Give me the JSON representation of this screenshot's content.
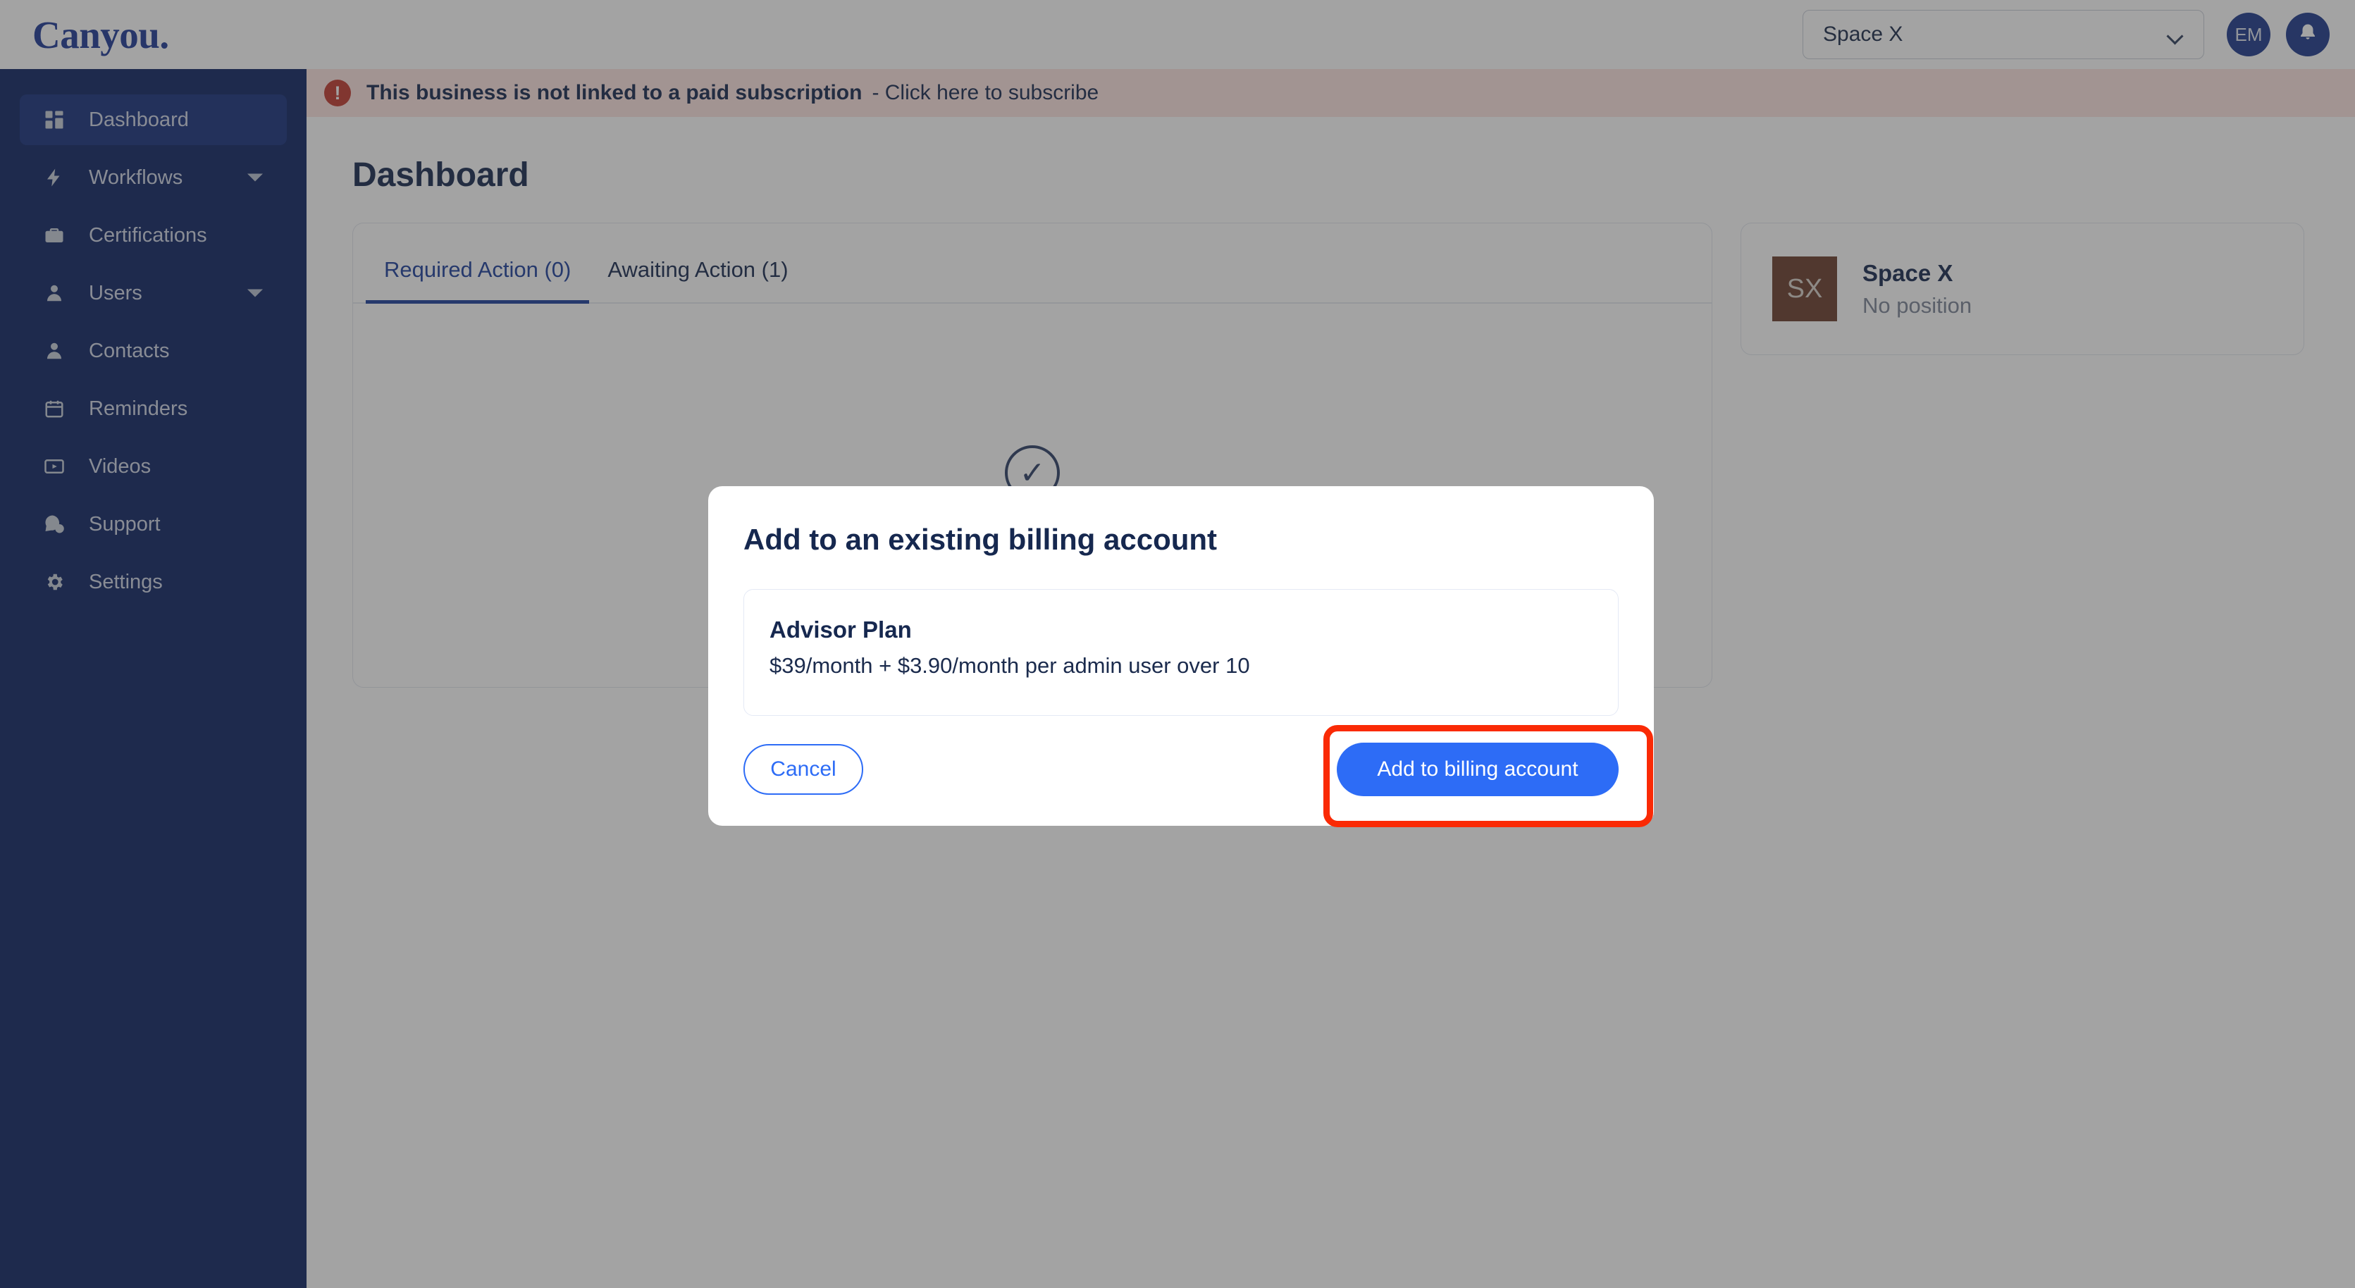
{
  "brand": {
    "logo_text": "Canyou.",
    "color": "#1e3a96"
  },
  "topbar": {
    "org_selector_value": "Space X",
    "avatar_initials": "EM",
    "notifications_icon": "bell-icon",
    "dropdown_icon": "chevron-down-icon"
  },
  "banner": {
    "icon": "alert-circle-icon",
    "message": "This business is not linked to a paid subscription",
    "link_text": "- Click here to subscribe",
    "background": "#fde3e1"
  },
  "sidebar": {
    "items": [
      {
        "label": "Dashboard",
        "icon": "grid-dashboard-icon",
        "active": true,
        "caret": false
      },
      {
        "label": "Workflows",
        "icon": "bolt-icon",
        "active": false,
        "caret": true
      },
      {
        "label": "Certifications",
        "icon": "briefcase-icon",
        "active": false,
        "caret": false
      },
      {
        "label": "Users",
        "icon": "user-icon",
        "active": false,
        "caret": true
      },
      {
        "label": "Contacts",
        "icon": "contact-person-icon",
        "active": false,
        "caret": false
      },
      {
        "label": "Reminders",
        "icon": "calendar-icon",
        "active": false,
        "caret": false
      },
      {
        "label": "Videos",
        "icon": "video-play-icon",
        "active": false,
        "caret": false
      },
      {
        "label": "Support",
        "icon": "chat-help-icon",
        "active": false,
        "caret": false
      },
      {
        "label": "Settings",
        "icon": "gear-icon",
        "active": false,
        "caret": false
      }
    ]
  },
  "page": {
    "title": "Dashboard",
    "tabs": [
      {
        "label": "Required Action (0)",
        "active": true
      },
      {
        "label": "Awaiting Action (1)",
        "active": false
      }
    ],
    "side_card": {
      "avatar_initials": "SX",
      "name": "Space X",
      "subtitle": "No position",
      "avatar_color": "#6a3c2c"
    }
  },
  "modal": {
    "title": "Add to an existing billing account",
    "plan": {
      "name": "Advisor Plan",
      "price": "$39/month + $3.90/month per admin user over 10"
    },
    "cancel_label": "Cancel",
    "submit_label": "Add to billing account",
    "primary_color": "#2d6cf6"
  },
  "highlight": {
    "color": "#fa2a05",
    "target": "add-to-billing-account-button"
  }
}
